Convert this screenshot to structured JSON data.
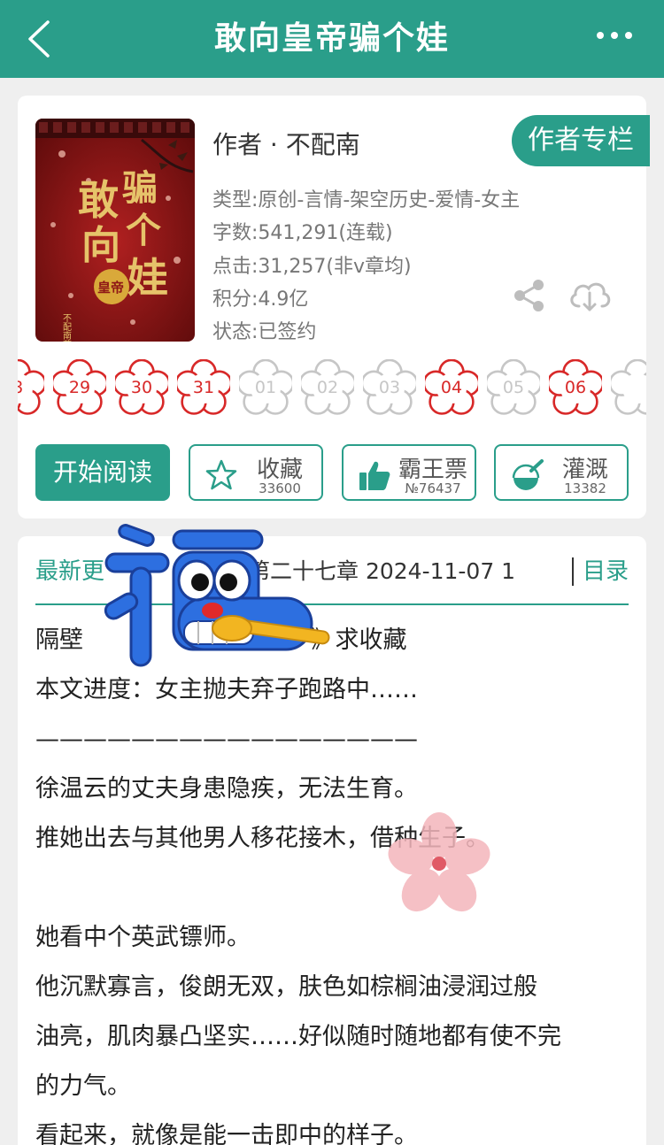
{
  "header": {
    "title": "敢向皇帝骗个娃",
    "back_icon": "chevron-left-icon",
    "more_icon": "more-dots-icon"
  },
  "book": {
    "cover_title_chars": [
      "敢",
      "向",
      "皇帝",
      "骗",
      "个",
      "娃"
    ],
    "cover_author": "不配南著",
    "author_line": "作者 · 不配南",
    "author_button": "作者专栏",
    "type": "类型:原创-言情-架空历史-爱情-女主",
    "words": "字数:541,291(连载)",
    "clicks": "点击:31,257(非v章均)",
    "points": "积分:4.9亿",
    "status": "状态:已签约"
  },
  "update_days": [
    {
      "label": "8",
      "active": true
    },
    {
      "label": "29",
      "active": true
    },
    {
      "label": "30",
      "active": true
    },
    {
      "label": "31",
      "active": true
    },
    {
      "label": "01",
      "active": false
    },
    {
      "label": "02",
      "active": false
    },
    {
      "label": "03",
      "active": false
    },
    {
      "label": "04",
      "active": true
    },
    {
      "label": "05",
      "active": false
    },
    {
      "label": "06",
      "active": true
    },
    {
      "label": "",
      "active": false
    }
  ],
  "actions": {
    "read": "开始阅读",
    "collect": {
      "label": "收藏",
      "count": "33600",
      "icon": "star-icon"
    },
    "ticket": {
      "label": "霸王票",
      "count": "№76437",
      "icon": "thumbs-up-icon"
    },
    "water": {
      "label": "灌溉",
      "count": "13382",
      "icon": "watering-bottle-icon"
    }
  },
  "latest": {
    "label": "最新更",
    "chapter": "第二十七章 2024-11-07 1",
    "toc": "目录"
  },
  "content": [
    "隔壁                              》求收藏",
    "本文进度：女主抛夫弃子跑路中……",
    "————————————————",
    "徐温云的丈夫身患隐疾，无法生育。",
    "推她出去与其他男人移花接木，借种生子。",
    "",
    "她看中个英武镖师。",
    "他沉默寡言，俊朗无双，肤色如棕榈油浸润过般",
    "油亮，肌肉暴凸坚实……好似随时随地都有使不完",
    "的力气。",
    "看起来，就像是能一击即中的样子。"
  ],
  "colors": {
    "primary": "#2a9e8a",
    "active_day": "#d82828",
    "inactive_day": "#c6c6c6",
    "cover_red": "#8e1616"
  }
}
